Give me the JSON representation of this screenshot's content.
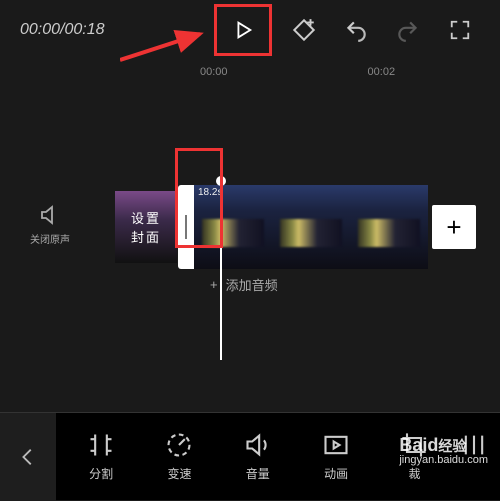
{
  "timer": {
    "display": "00:00/00:18"
  },
  "ruler": {
    "marks": [
      "00:00",
      "00:02"
    ]
  },
  "mute": {
    "label": "关闭原声"
  },
  "cover": {
    "line1": "设置",
    "line2": "封面"
  },
  "clip": {
    "duration": "18.2s"
  },
  "audio": {
    "label": "添加音频"
  },
  "tools": {
    "split": "分割",
    "speed": "变速",
    "volume": "音量",
    "animation": "动画",
    "crop_partial": "裁"
  },
  "watermark": {
    "brand": "Bai",
    "brand2": "经验",
    "url": "jingyan.baidu.com"
  },
  "annotations": {
    "arrow_color": "#e33",
    "box_color": "#e33"
  }
}
